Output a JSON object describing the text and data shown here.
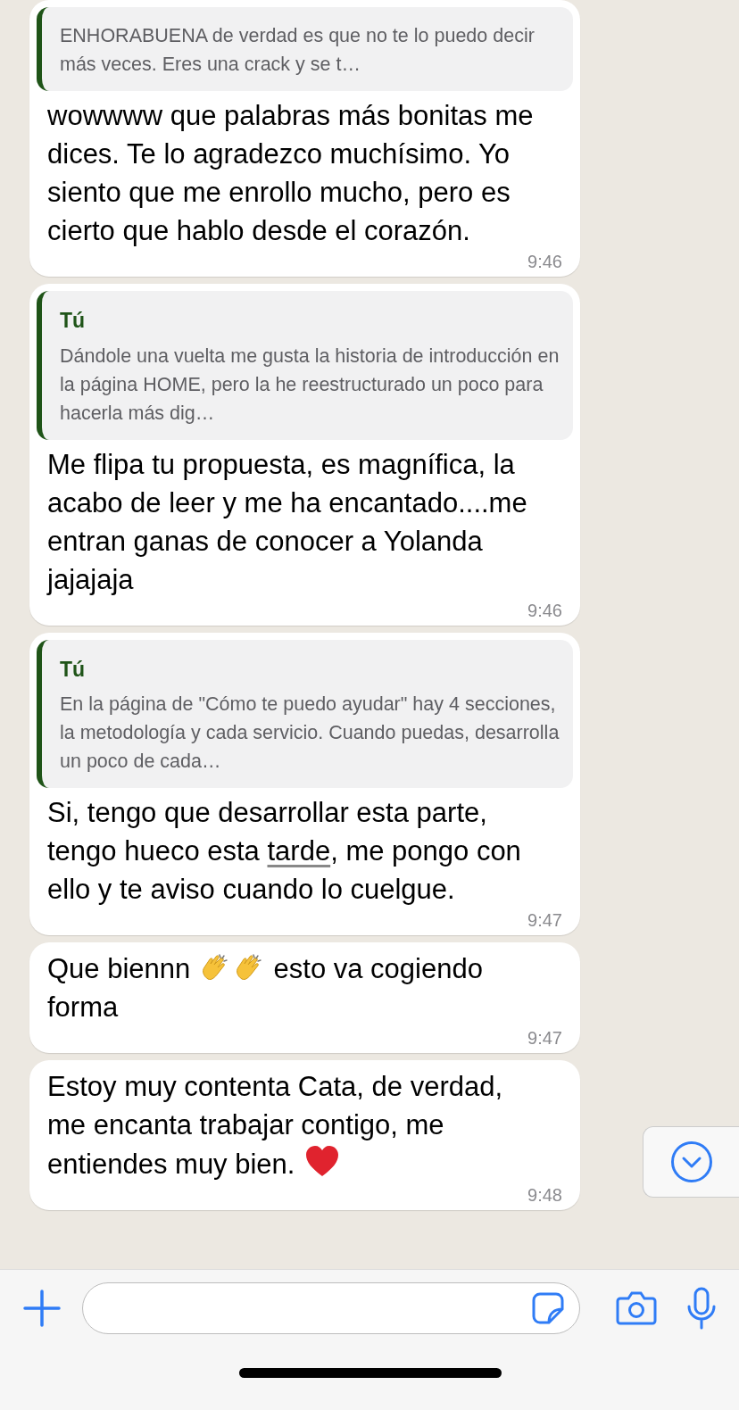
{
  "messages": [
    {
      "quote": {
        "text": "ENHORABUENA de verdad es que no te lo puedo decir más veces. Eres una crack y se t…"
      },
      "parts": [
        {
          "kind": "text",
          "text": "wowwww que palabras más bonitas me dices. Te lo agradezco muchísimo. Yo siento que me enrollo mucho, pero es cierto que hablo desde el corazón."
        }
      ],
      "time": "9:46"
    },
    {
      "quote": {
        "author": "Tú",
        "text": "Dándole una vuelta me gusta la historia de introducción en la página HOME, pero la he reestructurado un poco para hacerla más dig…"
      },
      "parts": [
        {
          "kind": "text",
          "text": "Me flipa tu propuesta, es magnífica, la acabo de leer y me ha encantado....me entran ganas de conocer a Yolanda jajajaja"
        }
      ],
      "time": "9:46"
    },
    {
      "quote": {
        "author": "Tú",
        "text": "En la página de \"Cómo te puedo ayudar\" hay 4 secciones, la metodología y cada servicio. Cuando puedas, desarrolla un poco de cada…"
      },
      "parts": [
        {
          "kind": "text",
          "text": "Si, tengo que desarrollar esta parte, tengo hueco esta "
        },
        {
          "kind": "underlined",
          "text": "tarde"
        },
        {
          "kind": "text",
          "text": ", me pongo con ello y te aviso cuando lo cuelgue."
        }
      ],
      "time": "9:47"
    },
    {
      "parts": [
        {
          "kind": "text",
          "text": "Que biennn "
        },
        {
          "kind": "clap"
        },
        {
          "kind": "clap"
        },
        {
          "kind": "text",
          "text": " esto va cogiendo forma"
        }
      ],
      "time": "9:47"
    },
    {
      "parts": [
        {
          "kind": "text",
          "text": "Estoy muy contenta Cata, de verdad, me encanta trabajar contigo, me entiendes muy bien. "
        },
        {
          "kind": "heart"
        }
      ],
      "time": "9:48"
    }
  ]
}
